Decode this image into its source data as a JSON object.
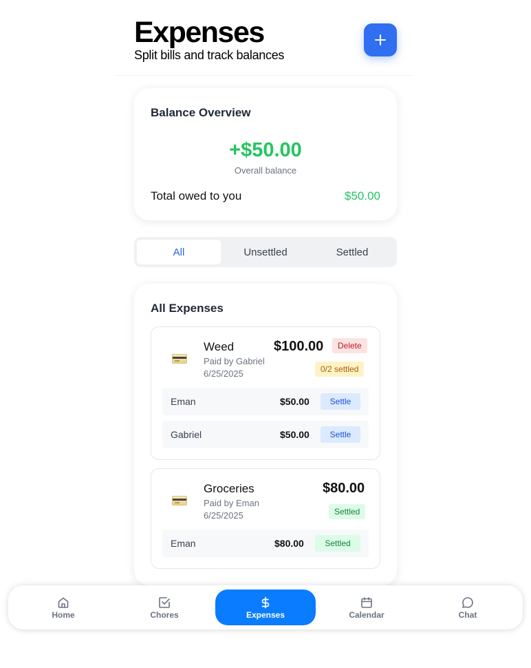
{
  "header": {
    "title": "Expenses",
    "subtitle": "Split bills and track balances"
  },
  "balance": {
    "title": "Balance Overview",
    "amount": "+$50.00",
    "amount_label": "Overall balance",
    "owed_label": "Total owed to you",
    "owed_value": "$50.00"
  },
  "tabs": [
    "All",
    "Unsettled",
    "Settled"
  ],
  "active_tab": "All",
  "expenses": {
    "title": "All Expenses",
    "items": [
      {
        "name": "Weed",
        "paid_by": "Paid by Gabriel",
        "date": "6/25/2025",
        "amount": "$100.00",
        "delete_label": "Delete",
        "status": "0/2 settled",
        "splits": [
          {
            "name": "Eman",
            "amount": "$50.00",
            "action": "Settle"
          },
          {
            "name": "Gabriel",
            "amount": "$50.00",
            "action": "Settle"
          }
        ]
      },
      {
        "name": "Groceries",
        "paid_by": "Paid by Eman",
        "date": "6/25/2025",
        "amount": "$80.00",
        "status": "Settled",
        "splits": [
          {
            "name": "Eman",
            "amount": "$80.00",
            "action": "Settled"
          }
        ]
      }
    ]
  },
  "nav": [
    {
      "label": "Home",
      "icon": "home-icon"
    },
    {
      "label": "Chores",
      "icon": "checkbox-icon"
    },
    {
      "label": "Expenses",
      "icon": "dollar-icon"
    },
    {
      "label": "Calendar",
      "icon": "calendar-icon"
    },
    {
      "label": "Chat",
      "icon": "chat-bubble-icon"
    }
  ],
  "active_nav": "Expenses",
  "colors": {
    "accent": "#2f6ff0",
    "nav_active": "#0a7cff",
    "positive": "#22c55e",
    "danger_bg": "#fde2e2",
    "warning_bg": "#fef3c7",
    "settled_bg": "#dcfce7",
    "settle_bg": "#dbeafe"
  }
}
